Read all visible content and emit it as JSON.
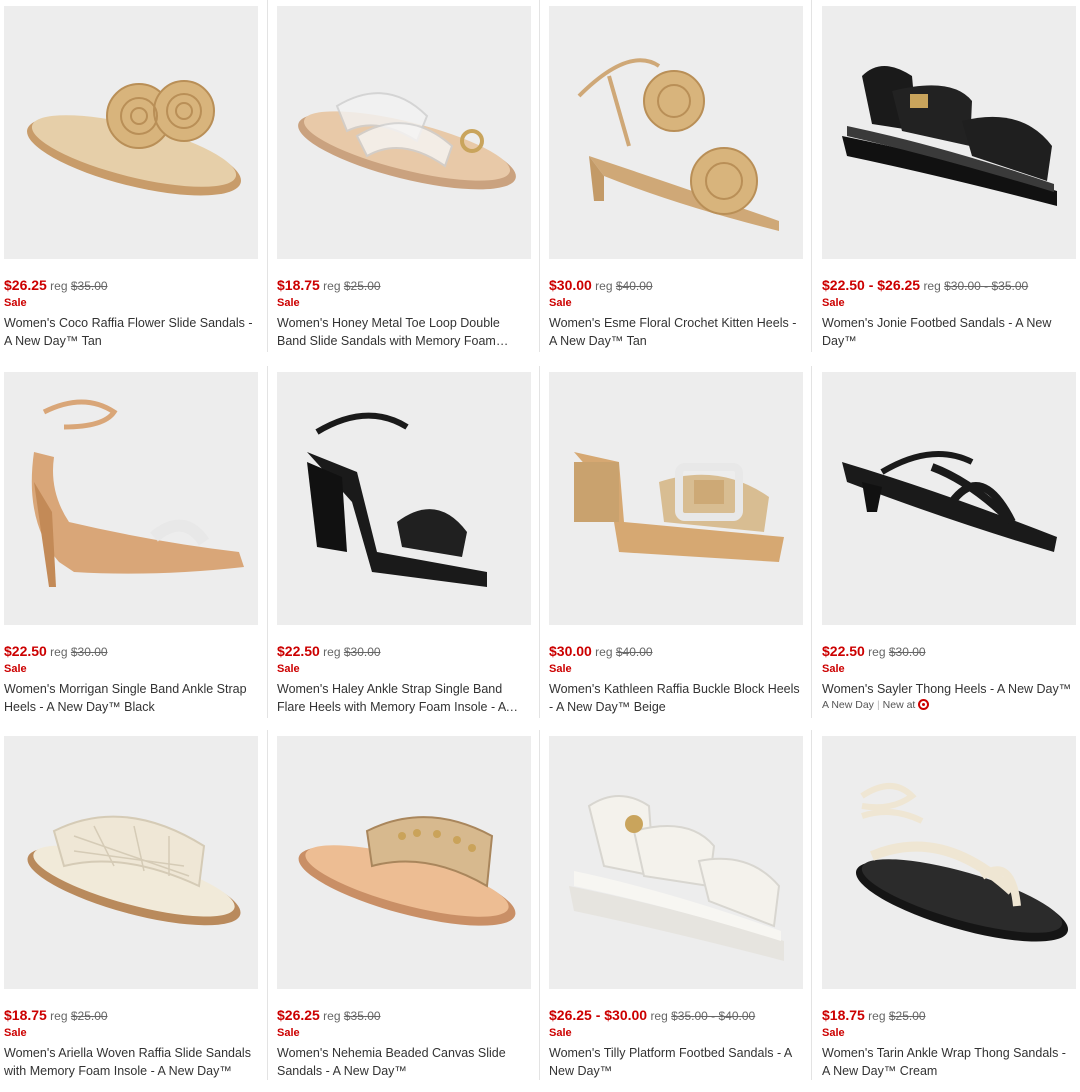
{
  "products": [
    {
      "sale_price": "$26.25",
      "reg_label": "reg",
      "reg_price": "$35.00",
      "sale_label": "Sale",
      "title": "Women's Coco Raffia Flower Slide Sandals - A New Day™ Tan",
      "image_icon": "raffia-flower-slide-sandal",
      "color": "#d8b98a"
    },
    {
      "sale_price": "$18.75",
      "reg_label": "reg",
      "reg_price": "$25.00",
      "sale_label": "Sale",
      "title": "Women's Honey Metal Toe Loop Double Band Slide Sandals with Memory Foam Insole - A New Day™",
      "image_icon": "clear-band-toe-loop-sandal",
      "color": "#e3c4a4"
    },
    {
      "sale_price": "$30.00",
      "reg_label": "reg",
      "reg_price": "$40.00",
      "sale_label": "Sale",
      "title": "Women's Esme Floral Crochet Kitten Heels - A New Day™ Tan",
      "image_icon": "floral-crochet-kitten-heel",
      "color": "#d8b98a"
    },
    {
      "sale_price": "$22.50 - $26.25",
      "reg_label": "reg",
      "reg_price": "$30.00 - $35.00",
      "sale_label": "Sale",
      "title": "Women's Jonie Footbed Sandals - A New Day™",
      "image_icon": "black-footbed-sandal",
      "color": "#1c1c1c"
    },
    {
      "sale_price": "$22.50",
      "reg_label": "reg",
      "reg_price": "$30.00",
      "sale_label": "Sale",
      "title": "Women's Morrigan Single Band Ankle Strap Heels - A New Day™ Black",
      "image_icon": "ankle-strap-stiletto-heel",
      "color": "#d9a678"
    },
    {
      "sale_price": "$22.50",
      "reg_label": "reg",
      "reg_price": "$30.00",
      "sale_label": "Sale",
      "title": "Women's Haley Ankle Strap Single Band Flare Heels with Memory Foam Insole - A New Day™",
      "image_icon": "black-block-heel-sandal",
      "color": "#1c1c1c"
    },
    {
      "sale_price": "$30.00",
      "reg_label": "reg",
      "reg_price": "$40.00",
      "sale_label": "Sale",
      "title": "Women's Kathleen Raffia Buckle Block Heels - A New Day™ Beige",
      "image_icon": "raffia-buckle-block-heel",
      "color": "#d2b48c"
    },
    {
      "sale_price": "$22.50",
      "reg_label": "reg",
      "reg_price": "$30.00",
      "sale_label": "Sale",
      "title": "Women's Sayler Thong Heels - A New Day™",
      "image_icon": "black-thong-kitten-heel",
      "color": "#1c1c1c",
      "brand": "A New Day",
      "new_at": "New at"
    },
    {
      "sale_price": "$18.75",
      "reg_label": "reg",
      "reg_price": "$25.00",
      "sale_label": "Sale",
      "title": "Women's Ariella Woven Raffia Slide Sandals with Memory Foam Insole - A New Day™",
      "image_icon": "woven-raffia-slide-sandal",
      "color": "#efe7d8"
    },
    {
      "sale_price": "$26.25",
      "reg_label": "reg",
      "reg_price": "$35.00",
      "sale_label": "Sale",
      "title": "Women's Nehemia Beaded Canvas Slide Sandals - A New Day™",
      "image_icon": "beaded-canvas-slide-sandal",
      "color": "#d2b48c"
    },
    {
      "sale_price": "$26.25 - $30.00",
      "reg_label": "reg",
      "reg_price": "$35.00 - $40.00",
      "sale_label": "Sale",
      "title": "Women's Tilly Platform Footbed Sandals - A New Day™",
      "image_icon": "white-platform-footbed-sandal",
      "color": "#f3f1ec"
    },
    {
      "sale_price": "$18.75",
      "reg_label": "reg",
      "reg_price": "$25.00",
      "sale_label": "Sale",
      "title": "Women's Tarin Ankle Wrap Thong Sandals - A New Day™ Cream",
      "image_icon": "ankle-wrap-thong-sandal",
      "color": "#1c1c1c"
    }
  ],
  "colors": {
    "sale_red": "#cc0000",
    "image_bg": "#ededed",
    "text": "#333333"
  }
}
